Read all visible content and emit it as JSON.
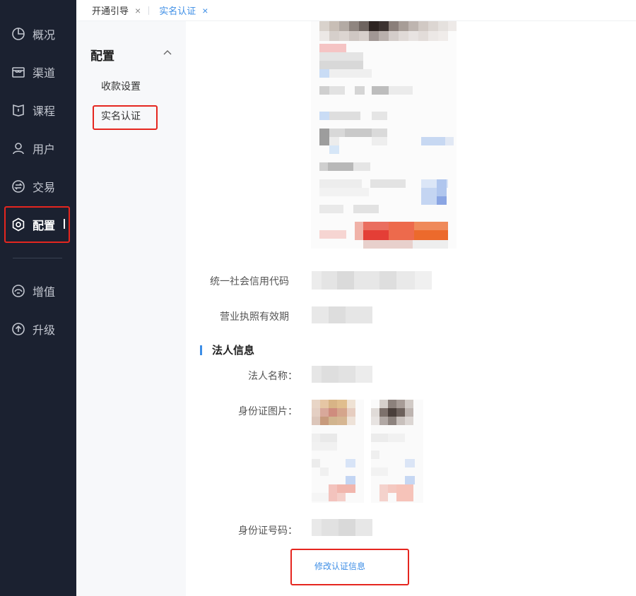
{
  "sidebar": {
    "items": [
      {
        "label": "概况",
        "icon": "pie-chart-icon"
      },
      {
        "label": "渠道",
        "icon": "store-icon"
      },
      {
        "label": "课程",
        "icon": "book-icon"
      },
      {
        "label": "用户",
        "icon": "user-icon"
      },
      {
        "label": "交易",
        "icon": "exchange-icon"
      },
      {
        "label": "配置",
        "icon": "gear-icon",
        "active": true
      },
      {
        "label": "增值",
        "icon": "value-added-icon"
      },
      {
        "label": "升级",
        "icon": "upgrade-arrow-icon"
      }
    ]
  },
  "tabs": [
    {
      "label": "开通引导",
      "close": "×"
    },
    {
      "label": "实名认证",
      "close": "×",
      "active": true
    }
  ],
  "submenu": {
    "title": "配置",
    "items": [
      {
        "label": "收款设置"
      },
      {
        "label": "实名认证",
        "active": true
      }
    ]
  },
  "form": {
    "credit_code_label": "统一社会信用代码",
    "license_validity_label": "营业执照有效期",
    "legal_section_title": "法人信息",
    "legal_name_label": "法人名称：",
    "id_photo_label": "身份证图片：",
    "id_number_label": "身份证号码：",
    "edit_link": "修改认证信息"
  },
  "colors": {
    "sidebar_bg": "#1b2130",
    "accent": "#3d8ee6",
    "annotation": "#e5261f"
  }
}
